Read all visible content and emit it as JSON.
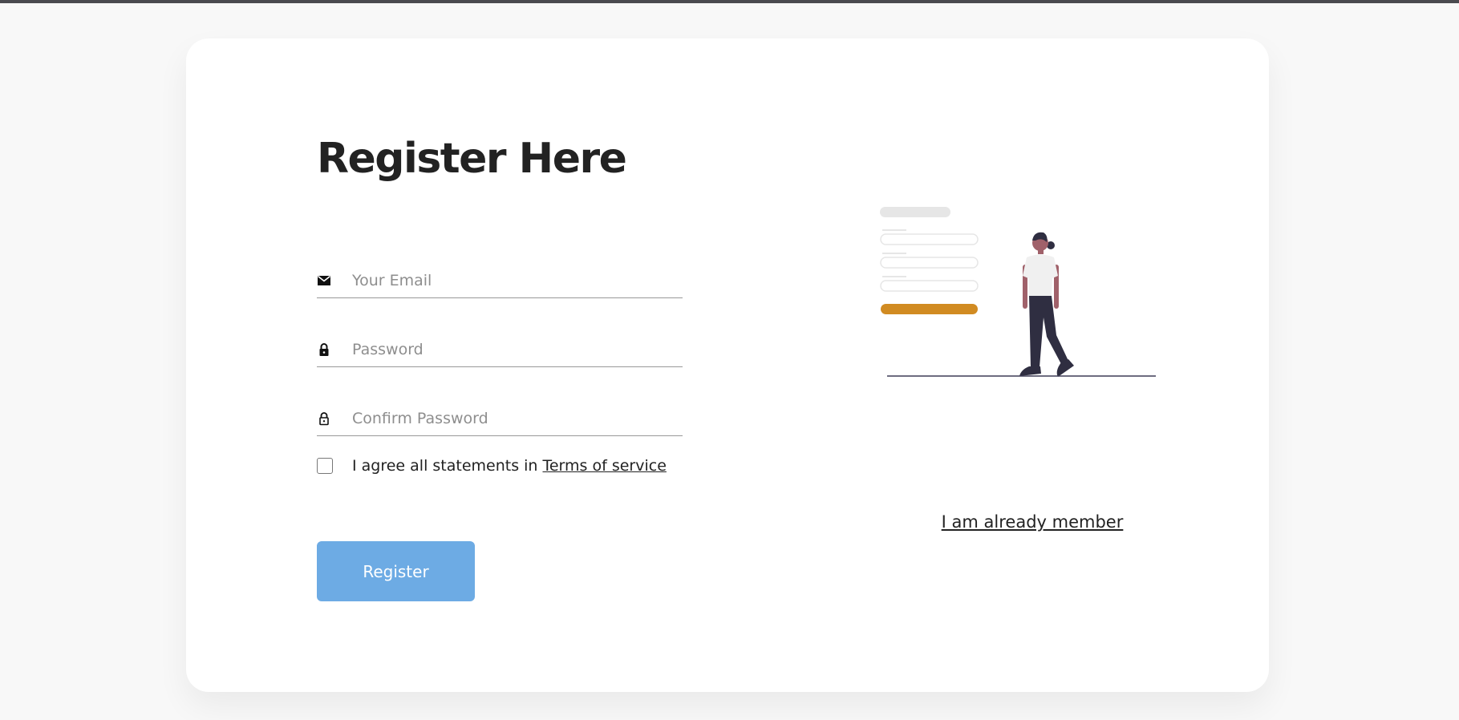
{
  "page": {
    "title": "Register Here"
  },
  "form": {
    "email": {
      "placeholder": "Your Email",
      "value": "",
      "icon": "envelope-icon"
    },
    "password": {
      "placeholder": "Password",
      "value": "",
      "icon": "lock-icon"
    },
    "confirm_password": {
      "placeholder": "Confirm Password",
      "value": "",
      "icon": "lock-outline-icon"
    },
    "agree": {
      "checked": false,
      "text": "I agree all statements in",
      "link_label": "Terms of service"
    },
    "register_label": "Register"
  },
  "side": {
    "illustration": "person-with-form-illustration",
    "member_link_label": "I am already member"
  },
  "colors": {
    "page_background": "#f8f8f8",
    "card": "#ffffff",
    "button": "#6dabe4",
    "illustration_accent": "#d18b22",
    "text": "#222222"
  }
}
